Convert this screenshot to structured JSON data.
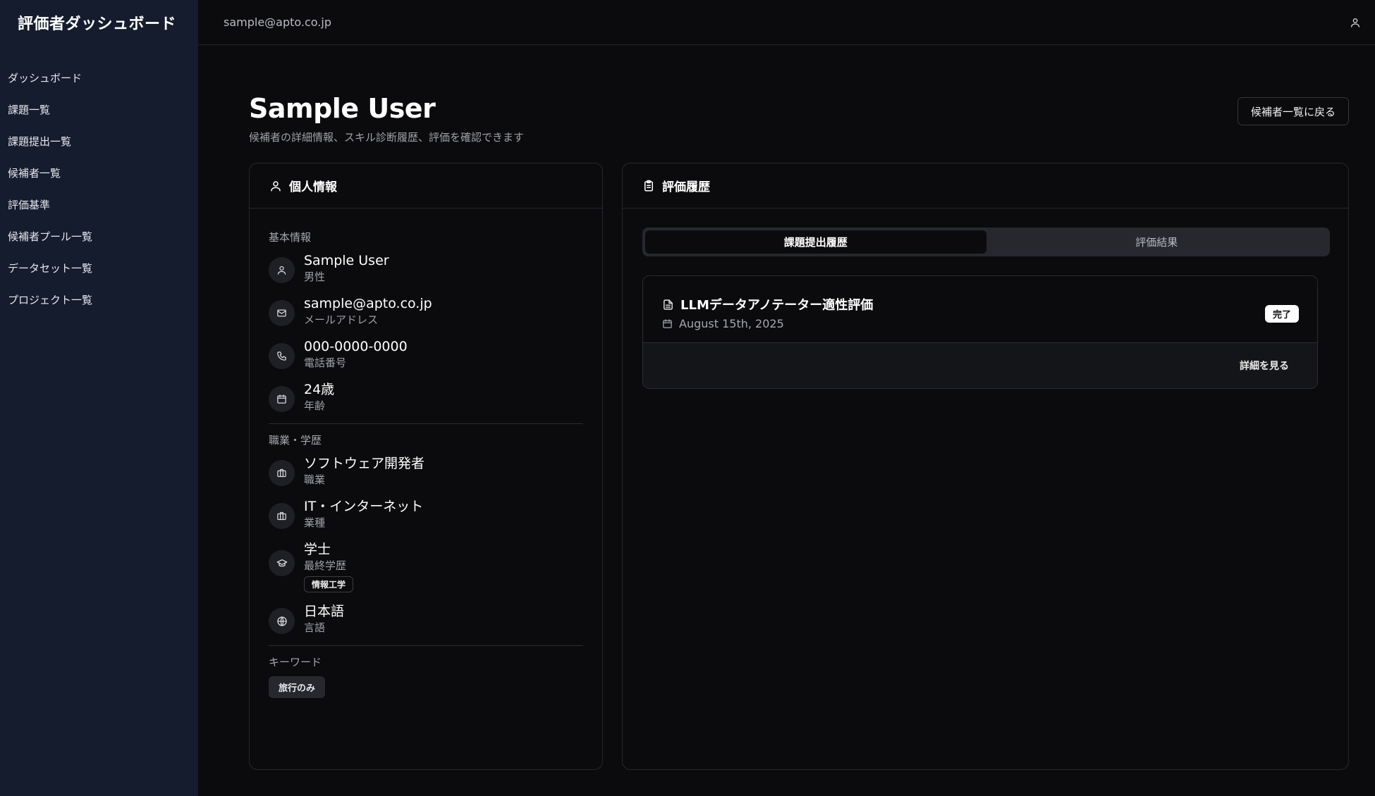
{
  "sidebar": {
    "brand": "評価者ダッシュボード",
    "items": [
      {
        "label": "ダッシュボード"
      },
      {
        "label": "課題一覧"
      },
      {
        "label": "課題提出一覧"
      },
      {
        "label": "候補者一覧"
      },
      {
        "label": "評価基準"
      },
      {
        "label": "候補者プール一覧"
      },
      {
        "label": "データセット一覧"
      },
      {
        "label": "プロジェクト一覧"
      }
    ]
  },
  "topbar": {
    "email": "sample@apto.co.jp",
    "user_icon": "user-icon"
  },
  "page": {
    "title": "Sample User",
    "subtitle": "候補者の詳細情報、スキル診断履歴、評価を確認できます",
    "back_button": "候補者一覧に戻る"
  },
  "personal": {
    "header": "個人情報",
    "basic_label": "基本情報",
    "basic": [
      {
        "value": "Sample User",
        "sub": "男性",
        "icon": "user-icon"
      },
      {
        "value": "sample@apto.co.jp",
        "sub": "メールアドレス",
        "icon": "mail-icon"
      },
      {
        "value": "000-0000-0000",
        "sub": "電話番号",
        "icon": "phone-icon"
      },
      {
        "value": "24歳",
        "sub": "年齢",
        "icon": "calendar-icon"
      }
    ],
    "career_label": "職業・学歴",
    "career": [
      {
        "value": "ソフトウェア開発者",
        "sub": "職業",
        "icon": "briefcase-icon"
      },
      {
        "value": "IT・インターネット",
        "sub": "業種",
        "icon": "briefcase-icon"
      },
      {
        "value": "学士",
        "sub": "最終学歴",
        "icon": "graduation-cap-icon",
        "tag": "情報工学"
      },
      {
        "value": "日本語",
        "sub": "言語",
        "icon": "globe-icon"
      }
    ],
    "keywords_label": "キーワード",
    "keywords": [
      "旅行のみ"
    ]
  },
  "history": {
    "header": "評価履歴",
    "tabs": [
      {
        "label": "課題提出履歴",
        "active": true
      },
      {
        "label": "評価結果",
        "active": false
      }
    ],
    "task": {
      "title": "LLMデータアノテーター適性評価",
      "date": "August 15th, 2025",
      "status": "完了",
      "details_link": "詳細を見る"
    }
  },
  "colors": {
    "sidebar_bg": "#141c2e",
    "page_bg": "#0b0b0d",
    "border": "#26282e"
  }
}
